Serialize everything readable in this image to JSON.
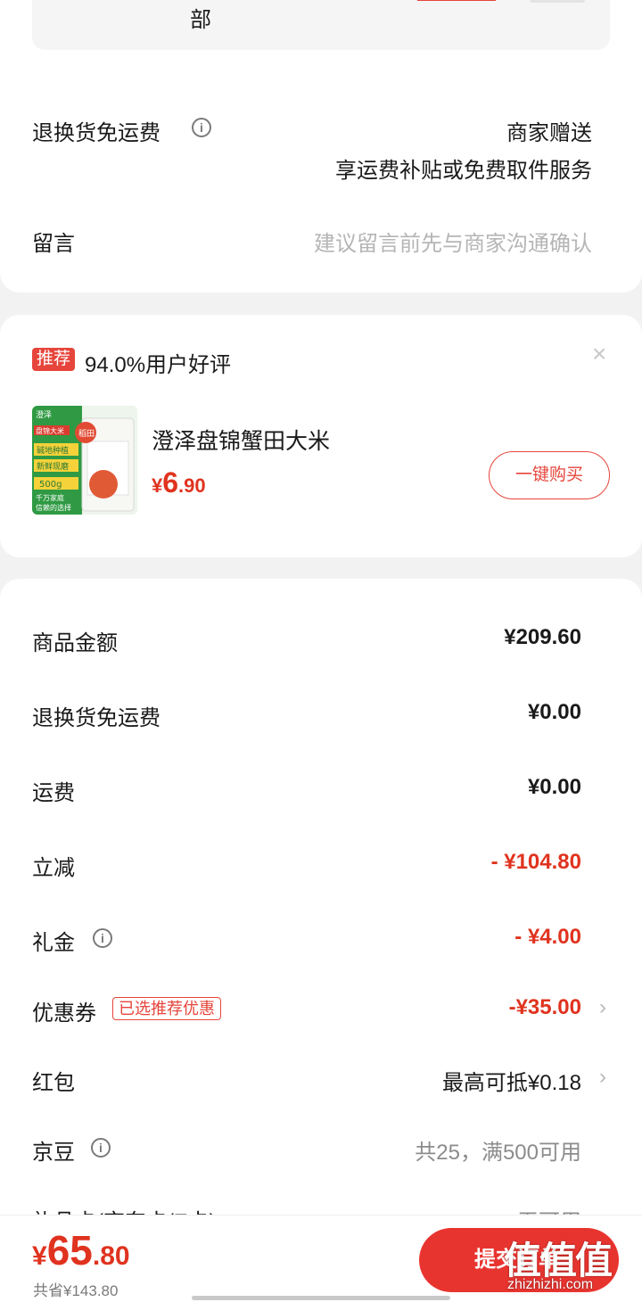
{
  "address": {
    "tail_text": "部"
  },
  "shipping": {
    "return_label": "退换货免运费",
    "return_value_line1": "商家赠送",
    "return_value_line2": "享运费补贴或免费取件服务",
    "message_label": "留言",
    "message_placeholder": "建议留言前先与商家沟通确认"
  },
  "recommend": {
    "tag": "推荐",
    "rating": "94.0%用户好评",
    "close_symbol": "×",
    "product": {
      "name": "澄泽盘锦蟹田大米",
      "price_symbol": "¥",
      "price_int": "6",
      "price_dec": ".90",
      "buy_label": "一键购买",
      "image_texts": {
        "brand": "澄泽",
        "tag1": "盘锦大米",
        "tag2": "稻田",
        "line1": "碱地种植",
        "line2": "新鲜现磨",
        "weight": "500g",
        "line3": "千万家庭",
        "line4": "信赖的选择"
      }
    }
  },
  "summary": {
    "rows": [
      {
        "label": "商品金额",
        "value": "¥209.60"
      },
      {
        "label": "退换货免运费",
        "value": "¥0.00"
      },
      {
        "label": "运费",
        "value": "¥0.00"
      },
      {
        "label": "立减",
        "value": "- ¥104.80"
      },
      {
        "label": "礼金",
        "value": "- ¥4.00"
      },
      {
        "label": "优惠券",
        "tag": "已选推荐优惠",
        "value": "-¥35.00"
      },
      {
        "label": "红包",
        "value": "最高可抵¥0.18"
      },
      {
        "label": "京豆",
        "value": "共25，满500可用"
      }
    ],
    "cut_label": "礼品卡(京东卡/E卡)",
    "cut_value": "无可用",
    "chevron": "›"
  },
  "bottom": {
    "price_symbol": "¥",
    "total_int": "65",
    "total_dec": ".80",
    "saved": "共省¥143.80",
    "submit_label": "提交订单"
  },
  "watermark": {
    "logo": "值值值",
    "site": "zhizhizhi.com"
  },
  "colors": {
    "accent": "#e6453b",
    "price_red": "#e0331f",
    "submit_bg": "#e8342f"
  }
}
